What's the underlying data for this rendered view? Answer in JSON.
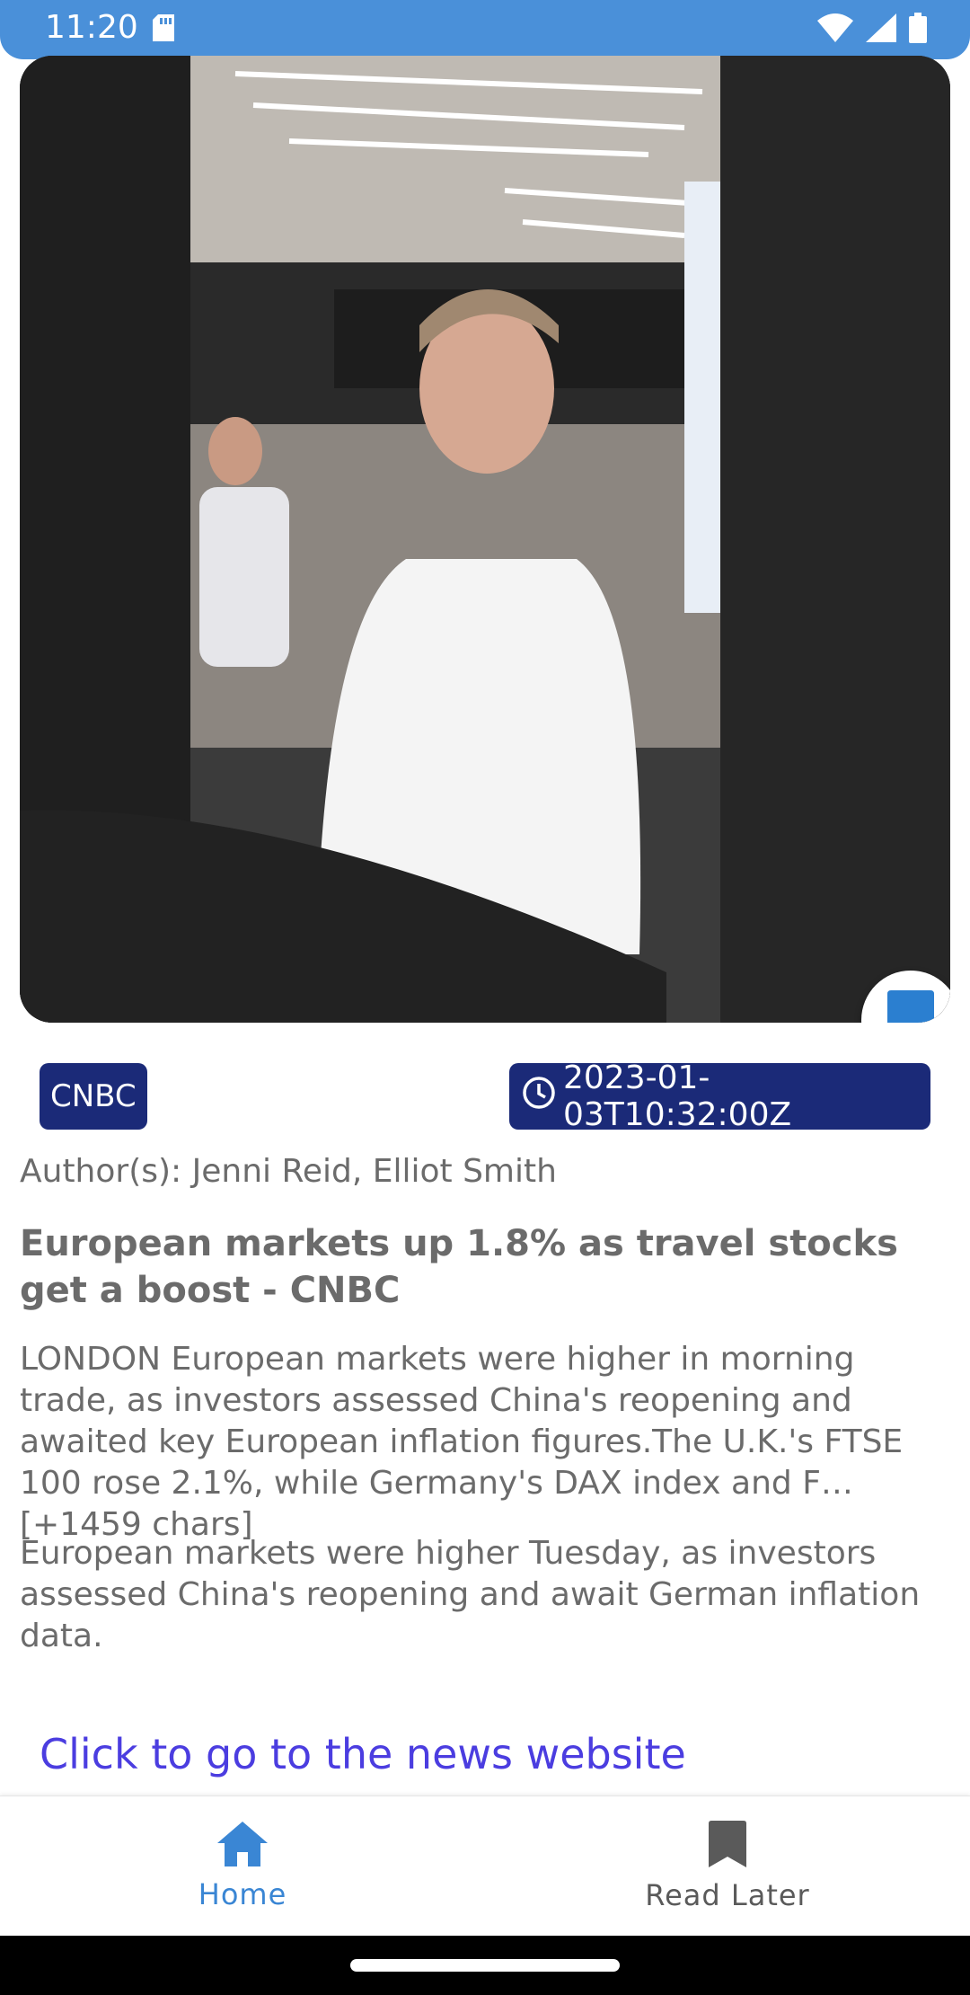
{
  "status_bar": {
    "time": "11:20",
    "icons": [
      "sd-card-icon",
      "wifi-icon",
      "signal-icon",
      "battery-icon"
    ],
    "color": "#4a90d9"
  },
  "article": {
    "image_description_icon": "news-photo",
    "source": "CNBC",
    "published_at": "2023-01-03T10:32:00Z",
    "authors": "Author(s): Jenni Reid, Elliot Smith",
    "title": "European markets up 1.8% as travel stocks get a boost - CNBC",
    "content": "LONDON European markets were higher in morning trade, as investors assessed China's reopening and awaited key European inflation figures.The U.K.'s FTSE 100 rose 2.1%, while Germany's DAX index and F… [+1459 chars]",
    "description": "European markets were higher Tuesday, as investors assessed China's reopening and await German inflation data.",
    "link_text": "Click to go to the news website",
    "chip_color": "#1b2a78",
    "link_color": "#4b3de0"
  },
  "bottom_nav": {
    "items": [
      {
        "label": "Home",
        "icon": "home-icon",
        "active": true
      },
      {
        "label": "Read Later",
        "icon": "bookmark-icon",
        "active": false
      }
    ],
    "active_color": "#3a86d4"
  }
}
